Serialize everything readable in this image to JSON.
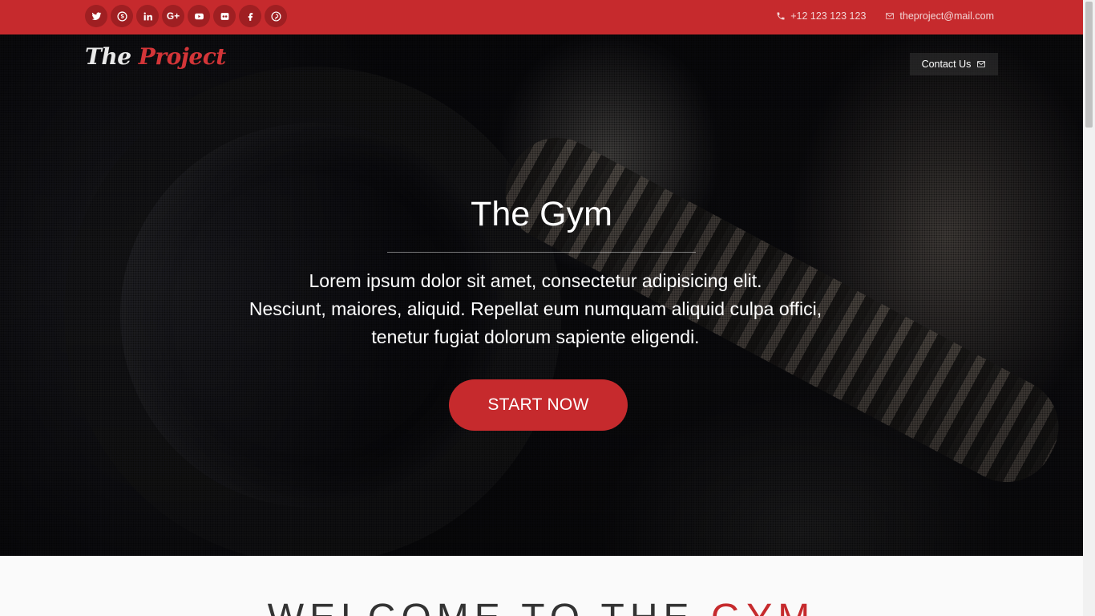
{
  "topbar": {
    "social_icons": [
      {
        "name": "twitter-icon",
        "glyph": "t"
      },
      {
        "name": "skype-icon",
        "glyph": "S"
      },
      {
        "name": "linkedin-icon",
        "glyph": "in"
      },
      {
        "name": "google-plus-icon",
        "glyph": "G+"
      },
      {
        "name": "youtube-icon",
        "glyph": "▶"
      },
      {
        "name": "flickr-icon",
        "glyph": "••"
      },
      {
        "name": "facebook-icon",
        "glyph": "f"
      },
      {
        "name": "pinterest-icon",
        "glyph": "P"
      }
    ],
    "phone": "+12 123 123 123",
    "email": "theproject@mail.com"
  },
  "logo": {
    "part1": "The ",
    "part2": "Project"
  },
  "nav": {
    "contact_label": "Contact Us"
  },
  "hero": {
    "title": "The Gym",
    "text_lines": [
      "Lorem ipsum dolor sit amet, consectetur adipisicing elit.",
      "Nesciunt, maiores, aliquid. Repellat eum numquam aliquid culpa offici,",
      "tenetur fugiat dolorum sapiente eligendi."
    ],
    "button_label": "START NOW"
  },
  "welcome": {
    "title_part1": "WELCOME TO THE ",
    "title_part2": "GYM"
  },
  "colors": {
    "brand_red": "#c62a2d",
    "dark_red": "#9f1f22"
  }
}
